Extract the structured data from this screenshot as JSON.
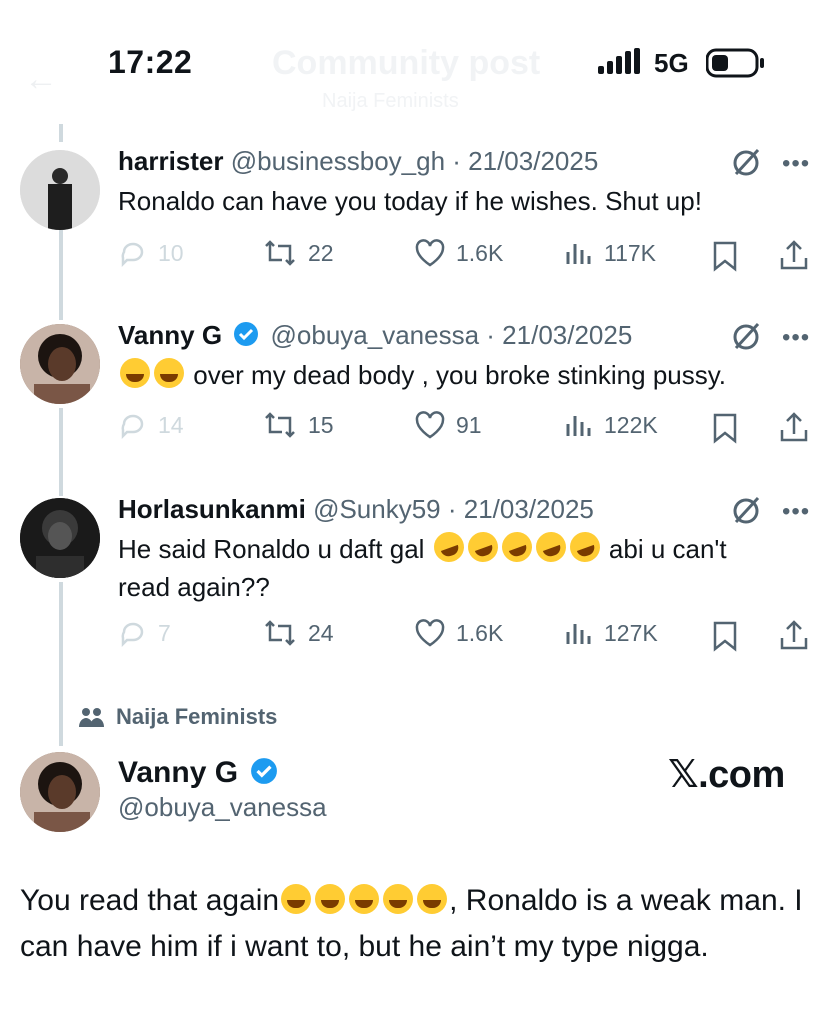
{
  "status_bar": {
    "time": "17:22",
    "network": "5G",
    "background_title": "Community post",
    "background_subtitle": "Naija Feminists"
  },
  "replies": [
    {
      "name": "harrister",
      "handle": "@businessboy_gh",
      "date": "· 21/03/2025",
      "verified": false,
      "text": "Ronaldo can have you today if he wishes. Shut up!",
      "replies_count": "10",
      "reposts": "22",
      "likes": "1.6K",
      "views": "117K"
    },
    {
      "name": "Vanny G",
      "handle": "@obuya_vanessa",
      "date": "· 21/03/2025",
      "verified": true,
      "emoji": "😂😂",
      "text": "over my dead body , you  broke stinking pussy.",
      "replies_count": "14",
      "reposts": "15",
      "likes": "91",
      "views": "122K"
    },
    {
      "name": "Horlasunkanmi",
      "handle": "@Sunky59",
      "date": "· 21/03/2025",
      "verified": false,
      "text_before": "He said Ronaldo u daft gal",
      "emoji": "🤣🤣🤣🤣🤣",
      "text_after": "abi u can't",
      "text_line2": "read again??",
      "replies_count": "7",
      "reposts": "24",
      "likes": "1.6K",
      "views": "127K"
    }
  ],
  "community_label": "Naija Feminists",
  "main_post": {
    "name": "Vanny G",
    "handle": "@obuya_vanessa",
    "verified": true,
    "watermark": "𝕏.com",
    "text_part1": "You read that again",
    "emoji": "😂😂😂😂😂",
    "text_part2": ", Ronaldo is a weak man. I can  have him if i want to,  but he ain’t my type nigga."
  },
  "colors": {
    "text_primary": "#0f1419",
    "text_secondary": "#536471",
    "verified_blue": "#1d9bf0",
    "thread_line": "#cfd9de"
  },
  "icons": [
    "reply-icon",
    "repost-icon",
    "like-icon",
    "views-icon",
    "bookmark-icon",
    "share-icon",
    "grok-icon",
    "more-icon",
    "verified-badge-icon",
    "community-icon"
  ]
}
